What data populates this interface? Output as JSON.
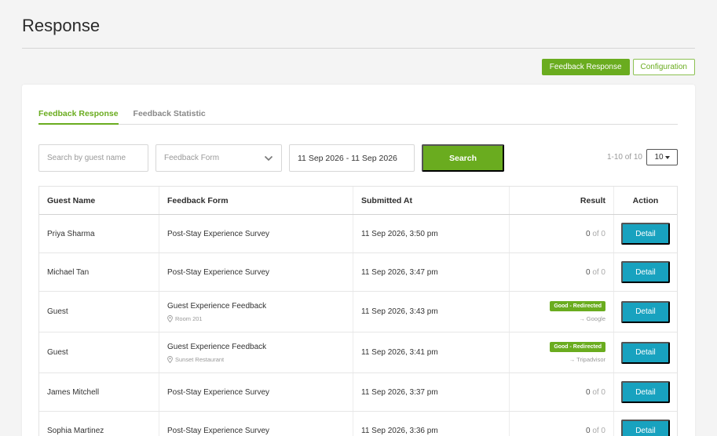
{
  "page": {
    "title": "Response"
  },
  "top_buttons": {
    "feedback_response": "Feedback Response",
    "configuration": "Configuration"
  },
  "tabs": [
    {
      "label": "Feedback Response",
      "active": true
    },
    {
      "label": "Feedback Statistic",
      "active": false
    }
  ],
  "filters": {
    "search_placeholder": "Search by guest name",
    "form_placeholder": "Feedback Form",
    "date_range": "11 Sep 2026 - 11 Sep 2026",
    "search_button": "Search",
    "pager_info": "1-10 of 10",
    "page_size": "10"
  },
  "table": {
    "headers": [
      "Guest Name",
      "Feedback Form",
      "Submitted At",
      "Result",
      "Action"
    ],
    "rows": [
      {
        "guest": "Priya Sharma",
        "form": "Post-Stay Experience Survey",
        "location": "",
        "submitted": "11 Sep 2026, 3:50 pm",
        "score": "0",
        "total": "of 0",
        "badge": "",
        "redirect": "",
        "action": "Detail"
      },
      {
        "guest": "Michael Tan",
        "form": "Post-Stay Experience Survey",
        "location": "",
        "submitted": "11 Sep 2026, 3:47 pm",
        "score": "0",
        "total": "of 0",
        "badge": "",
        "redirect": "",
        "action": "Detail"
      },
      {
        "guest": "Guest",
        "form": "Guest Experience Feedback",
        "location": "Room 201",
        "submitted": "11 Sep 2026, 3:43 pm",
        "score": "",
        "total": "",
        "badge": "Good - Redirected",
        "redirect": "→ Google",
        "action": "Detail"
      },
      {
        "guest": "Guest",
        "form": "Guest Experience Feedback",
        "location": "Sunset Restaurant",
        "submitted": "11 Sep 2026, 3:41 pm",
        "score": "",
        "total": "",
        "badge": "Good - Redirected",
        "redirect": "→ Tripadvisor",
        "action": "Detail"
      },
      {
        "guest": "James Mitchell",
        "form": "Post-Stay Experience Survey",
        "location": "",
        "submitted": "11 Sep 2026, 3:37 pm",
        "score": "0",
        "total": "of 0",
        "badge": "",
        "redirect": "",
        "action": "Detail"
      },
      {
        "guest": "Sophia Martinez",
        "form": "Post-Stay Experience Survey",
        "location": "",
        "submitted": "11 Sep 2026, 3:36 pm",
        "score": "0",
        "total": "of 0",
        "badge": "",
        "redirect": "",
        "action": "Detail"
      }
    ]
  },
  "icons": {
    "dropdown": "chevron-down-icon",
    "location": "location-pin-icon",
    "caret": "caret-down-icon"
  },
  "colors": {
    "accent": "#6aac1f",
    "detail_button": "#18a2bf"
  }
}
